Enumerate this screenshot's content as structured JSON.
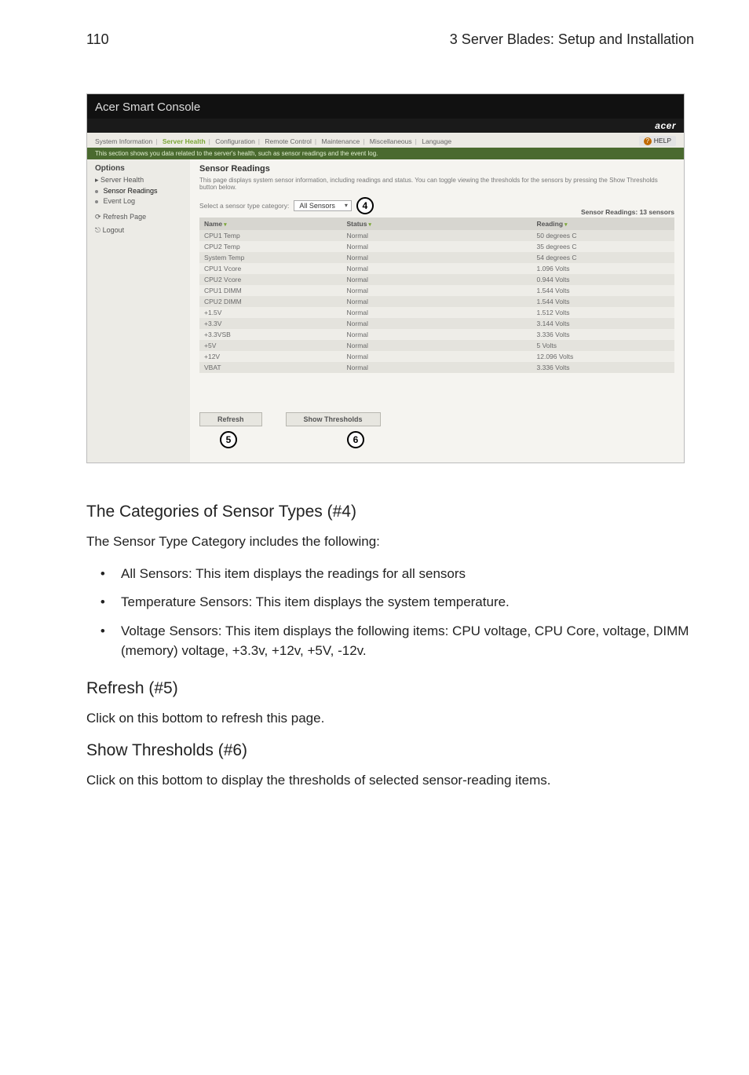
{
  "page_header": {
    "number": "110",
    "title": "3 Server Blades: Setup and Installation"
  },
  "screenshot": {
    "window_title": "Acer Smart Console",
    "brand": "acer",
    "tabs": [
      "System Information",
      "Server Health",
      "Configuration",
      "Remote Control",
      "Maintenance",
      "Miscellaneous",
      "Language"
    ],
    "active_tab": "Server Health",
    "help_label": "HELP",
    "info_bar": "This section shows you data related to the server's health, such as sensor readings and the event log.",
    "sidebar": {
      "options_label": "Options",
      "items": [
        {
          "label": "Server Health",
          "icon": "folder-icon"
        },
        {
          "label": "Sensor Readings",
          "icon": "dot-icon",
          "active": true
        },
        {
          "label": "Event Log",
          "icon": "dot-icon"
        }
      ],
      "refresh_label": "Refresh Page",
      "logout_label": "Logout"
    },
    "main": {
      "heading": "Sensor Readings",
      "description": "This page displays system sensor information, including readings and status. You can toggle viewing the thresholds for the sensors by pressing the Show Thresholds button below.",
      "select_label": "Select a sensor type category:",
      "select_value": "All Sensors",
      "callout_select": "4",
      "count_label": "Sensor Readings: 13 sensors",
      "columns": {
        "name": "Name",
        "status": "Status",
        "reading": "Reading"
      },
      "rows": [
        {
          "name": "CPU1 Temp",
          "status": "Normal",
          "reading": "50 degrees C"
        },
        {
          "name": "CPU2 Temp",
          "status": "Normal",
          "reading": "35 degrees C"
        },
        {
          "name": "System Temp",
          "status": "Normal",
          "reading": "54 degrees C"
        },
        {
          "name": "CPU1 Vcore",
          "status": "Normal",
          "reading": "1.096 Volts"
        },
        {
          "name": "CPU2 Vcore",
          "status": "Normal",
          "reading": "0.944 Volts"
        },
        {
          "name": "CPU1 DIMM",
          "status": "Normal",
          "reading": "1.544 Volts"
        },
        {
          "name": "CPU2 DIMM",
          "status": "Normal",
          "reading": "1.544 Volts"
        },
        {
          "name": "+1.5V",
          "status": "Normal",
          "reading": "1.512 Volts"
        },
        {
          "name": "+3.3V",
          "status": "Normal",
          "reading": "3.144 Volts"
        },
        {
          "name": "+3.3VSB",
          "status": "Normal",
          "reading": "3.336 Volts"
        },
        {
          "name": "+5V",
          "status": "Normal",
          "reading": "5 Volts"
        },
        {
          "name": "+12V",
          "status": "Normal",
          "reading": "12.096 Volts"
        },
        {
          "name": "VBAT",
          "status": "Normal",
          "reading": "3.336 Volts"
        }
      ],
      "buttons": {
        "refresh": "Refresh",
        "show_thresholds": "Show Thresholds"
      },
      "callout_refresh": "5",
      "callout_show": "6"
    }
  },
  "body": {
    "h_cat": "The Categories of Sensor Types (#4)",
    "p_cat": "The Sensor Type Category includes the following:",
    "bullets": [
      "All Sensors: This item displays the readings for all sensors",
      "Temperature Sensors: This item displays the system temperature.",
      "Voltage Sensors: This item displays the following items: CPU voltage, CPU Core, voltage, DIMM (memory) voltage, +3.3v, +12v, +5V, -12v."
    ],
    "h_refresh": "Refresh (#5)",
    "p_refresh": "Click on this bottom to refresh this page.",
    "h_show": "Show Thresholds (#6)",
    "p_show": "Click on this bottom to display the thresholds of selected sensor-reading items."
  }
}
